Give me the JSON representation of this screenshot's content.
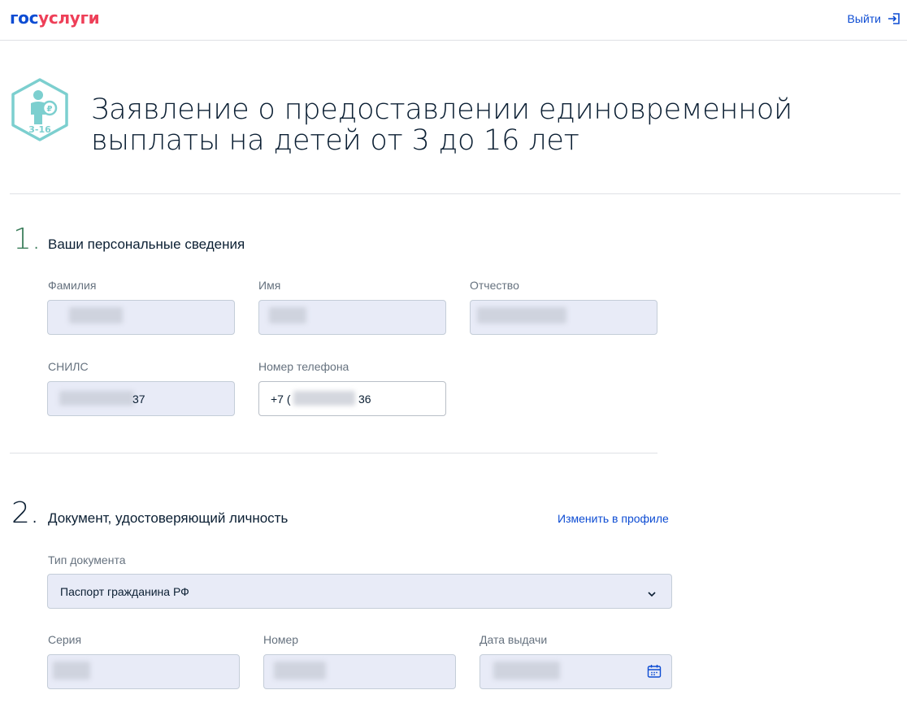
{
  "header": {
    "logo_part1": "гос",
    "logo_part2": "услуги",
    "exit_label": "Выйти"
  },
  "hero": {
    "icon_badge": "3-16",
    "title": "Заявление о предоставлении единовременной выплаты на детей от 3 до 16 лет"
  },
  "section1": {
    "number": "1.",
    "title": "Ваши персональные сведения",
    "fields": {
      "surname_label": "Фамилия",
      "name_label": "Имя",
      "patronymic_label": "Отчество",
      "snils_label": "СНИЛС",
      "snils_visible_suffix": "37",
      "phone_label": "Номер телефона",
      "phone_prefix": "+7 (",
      "phone_visible_suffix": "36"
    }
  },
  "section2": {
    "number": "2.",
    "title": "Документ, удостоверяющий личность",
    "change_link": "Изменить в профиле",
    "doc_type_label": "Тип документа",
    "doc_type_value": "Паспорт гражданина РФ",
    "series_label": "Серия",
    "number_label": "Номер",
    "issue_date_label": "Дата выдачи"
  },
  "colors": {
    "brand_blue": "#0d4cd3",
    "brand_red": "#ee3f58",
    "field_bg": "#e8ebf7",
    "icon_teal": "#7ccfcf"
  },
  "icons": [
    "exit-icon",
    "child-ruble-icon",
    "chevron-down-icon",
    "calendar-icon"
  ]
}
